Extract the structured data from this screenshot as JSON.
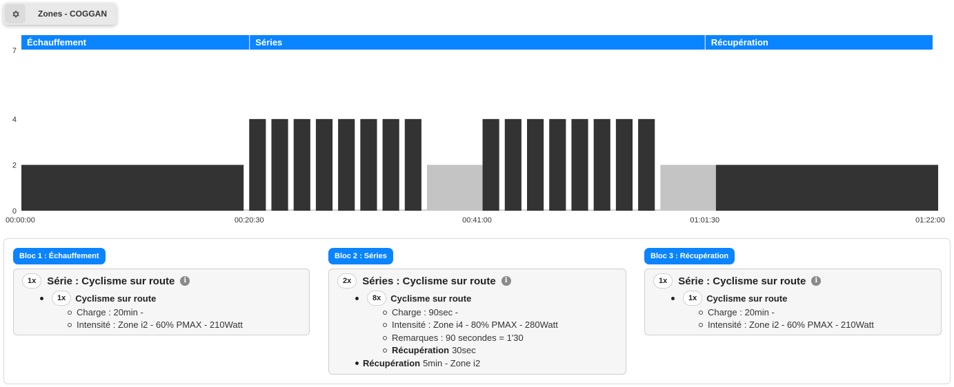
{
  "zones_button": {
    "label": "Zones - COGGAN",
    "icon": "gear-icon"
  },
  "chart_data": {
    "type": "bar",
    "y_ticks": [
      "0",
      "2",
      "4",
      "7"
    ],
    "ylim": [
      0,
      7
    ],
    "x_ticks": [
      "00:00:00",
      "00:20:30",
      "00:41:00",
      "01:01:30",
      "01:22:00"
    ],
    "xlim_seconds": [
      0,
      4920
    ],
    "phases": [
      {
        "label": "Échauffement",
        "start": 0,
        "end": 1230
      },
      {
        "label": "Séries",
        "start": 1230,
        "end": 3690
      },
      {
        "label": "Récupération",
        "start": 3690,
        "end": 4920
      }
    ],
    "segments": [
      {
        "start": 0,
        "duration": 1200,
        "zone": 2,
        "kind": "effort"
      },
      {
        "start": 1230,
        "duration": 90,
        "zone": 4,
        "kind": "effort"
      },
      {
        "start": 1350,
        "duration": 90,
        "zone": 4,
        "kind": "effort"
      },
      {
        "start": 1470,
        "duration": 90,
        "zone": 4,
        "kind": "effort"
      },
      {
        "start": 1590,
        "duration": 90,
        "zone": 4,
        "kind": "effort"
      },
      {
        "start": 1710,
        "duration": 90,
        "zone": 4,
        "kind": "effort"
      },
      {
        "start": 1830,
        "duration": 90,
        "zone": 4,
        "kind": "effort"
      },
      {
        "start": 1950,
        "duration": 90,
        "zone": 4,
        "kind": "effort"
      },
      {
        "start": 2070,
        "duration": 90,
        "zone": 4,
        "kind": "effort"
      },
      {
        "start": 2190,
        "duration": 300,
        "zone": 2,
        "kind": "recovery"
      },
      {
        "start": 2490,
        "duration": 90,
        "zone": 4,
        "kind": "effort"
      },
      {
        "start": 2610,
        "duration": 90,
        "zone": 4,
        "kind": "effort"
      },
      {
        "start": 2730,
        "duration": 90,
        "zone": 4,
        "kind": "effort"
      },
      {
        "start": 2850,
        "duration": 90,
        "zone": 4,
        "kind": "effort"
      },
      {
        "start": 2970,
        "duration": 90,
        "zone": 4,
        "kind": "effort"
      },
      {
        "start": 3090,
        "duration": 90,
        "zone": 4,
        "kind": "effort"
      },
      {
        "start": 3210,
        "duration": 90,
        "zone": 4,
        "kind": "effort"
      },
      {
        "start": 3330,
        "duration": 90,
        "zone": 4,
        "kind": "effort"
      },
      {
        "start": 3450,
        "duration": 300,
        "zone": 2,
        "kind": "recovery"
      },
      {
        "start": 3750,
        "duration": 1200,
        "zone": 2,
        "kind": "effort"
      }
    ],
    "colors": {
      "effort": "#333333",
      "recovery": "#c4c4c4",
      "phase": "#0a84ff",
      "low": "#d0d0d0"
    }
  },
  "blocs": [
    {
      "badge": "Bloc 1 : Échauffement",
      "serie_mult": "1x",
      "serie_title": "Série : Cyclisme sur route",
      "sub_mult": "1x",
      "sub_title": "Cyclisme sur route",
      "details": [
        {
          "text": "Charge : 20min -"
        },
        {
          "text": "Intensité : Zone i2 - 60% PMAX - 210Watt"
        }
      ],
      "footer_label": "",
      "footer_value": ""
    },
    {
      "badge": "Bloc 2 : Séries",
      "serie_mult": "2x",
      "serie_title": "Séries : Cyclisme sur route",
      "sub_mult": "8x",
      "sub_title": "Cyclisme sur route",
      "details": [
        {
          "text": "Charge : 90sec -"
        },
        {
          "text": "Intensité : Zone i4 - 80% PMAX - 280Watt"
        },
        {
          "text": "Remarques : 90 secondes = 1'30"
        }
      ],
      "detail_recup_label": "Récupération",
      "detail_recup_value": "30sec",
      "footer_label": "Récupération",
      "footer_value": "5min - Zone i2"
    },
    {
      "badge": "Bloc 3 : Récupération",
      "serie_mult": "1x",
      "serie_title": "Série : Cyclisme sur route",
      "sub_mult": "1x",
      "sub_title": "Cyclisme sur route",
      "details": [
        {
          "text": "Charge : 20min -"
        },
        {
          "text": "Intensité : Zone i2 - 60% PMAX - 210Watt"
        }
      ],
      "footer_label": "",
      "footer_value": ""
    }
  ]
}
